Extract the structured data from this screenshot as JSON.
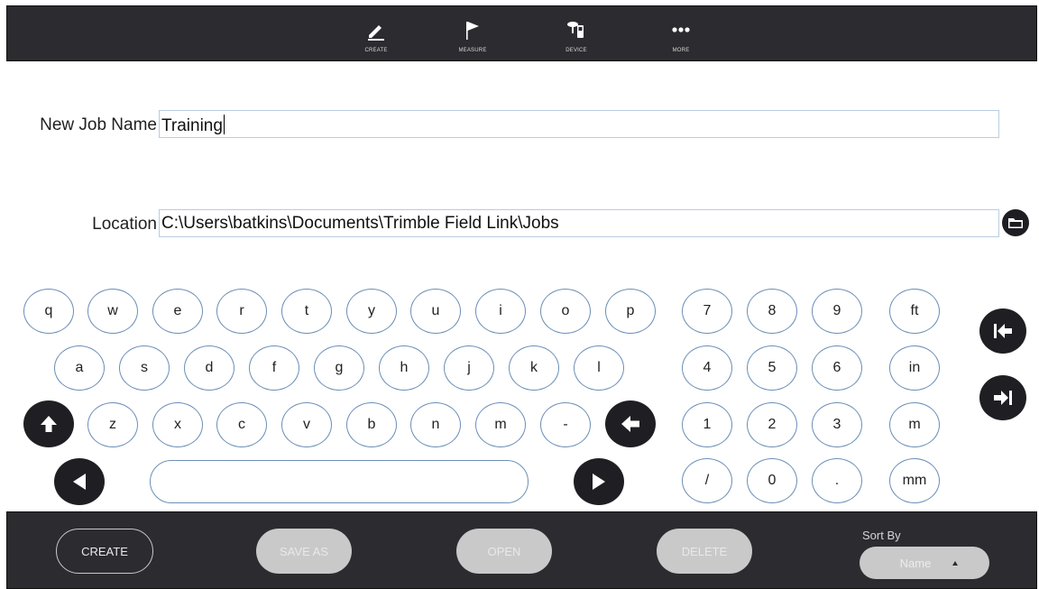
{
  "topnav": {
    "items": [
      {
        "label": "CREATE",
        "icon": "pencil-icon"
      },
      {
        "label": "MEASURE",
        "icon": "flag-icon"
      },
      {
        "label": "DEVICE",
        "icon": "device-icon"
      },
      {
        "label": "MORE",
        "icon": "more-dots-icon"
      }
    ]
  },
  "form": {
    "job_name_label": "New Job Name",
    "job_name_value": "Training",
    "location_label": "Location",
    "location_value": "C:\\Users\\batkins\\Documents\\Trimble Field Link\\Jobs"
  },
  "keyboard": {
    "row1": [
      "q",
      "w",
      "e",
      "r",
      "t",
      "y",
      "u",
      "i",
      "o",
      "p"
    ],
    "row2": [
      "a",
      "s",
      "d",
      "f",
      "g",
      "h",
      "j",
      "k",
      "l"
    ],
    "row3": [
      "z",
      "x",
      "c",
      "v",
      "b",
      "n",
      "m",
      "-"
    ],
    "numpad": [
      [
        "7",
        "8",
        "9",
        "ft"
      ],
      [
        "4",
        "5",
        "6",
        "in"
      ],
      [
        "1",
        "2",
        "3",
        "m"
      ],
      [
        "/",
        "0",
        ".",
        "mm"
      ]
    ]
  },
  "bottombar": {
    "create_label": "CREATE",
    "save_as_label": "SAVE AS",
    "open_label": "OPEN",
    "delete_label": "DELETE",
    "sort_by_label": "Sort By",
    "sort_by_value": "Name"
  },
  "colors": {
    "bar_bg": "#2b2b30",
    "key_border": "#6c8fb7",
    "disabled_pill": "#c9c9c9",
    "field_border": "#b9cde3"
  }
}
